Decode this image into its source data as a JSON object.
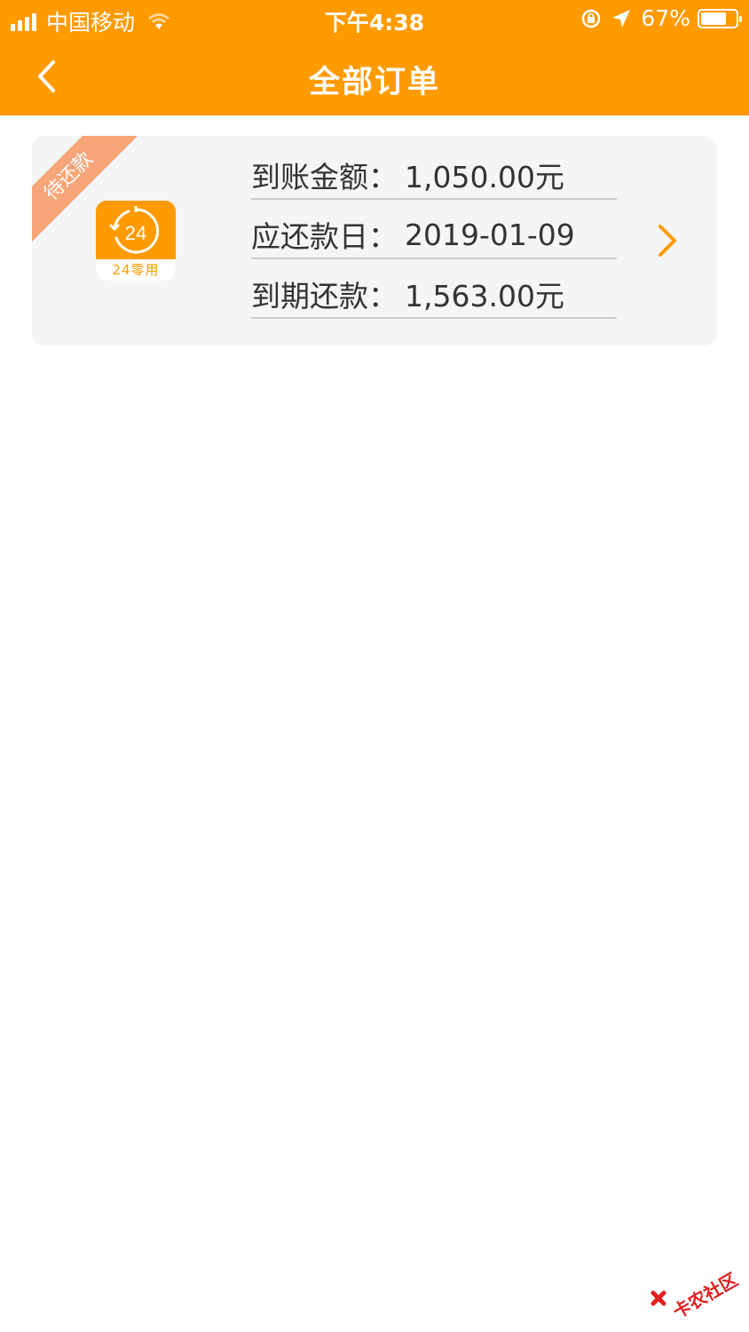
{
  "status_bar": {
    "carrier": "中国移动",
    "time": "下午4:38",
    "battery_percent": "67%"
  },
  "nav": {
    "title": "全部订单"
  },
  "order": {
    "badge": "待还款",
    "app_logo_text": "24",
    "app_name": "24零用",
    "rows": [
      {
        "label": "到账金额：",
        "value": "1,050.00元"
      },
      {
        "label": "应还款日：",
        "value": "2019-01-09"
      },
      {
        "label": "到期还款：",
        "value": "1,563.00元"
      }
    ]
  },
  "watermark": {
    "text": "卡农社区"
  },
  "colors": {
    "brand": "#FF9A00",
    "badge": "#F6A678",
    "card_bg": "#F5F5F5"
  }
}
